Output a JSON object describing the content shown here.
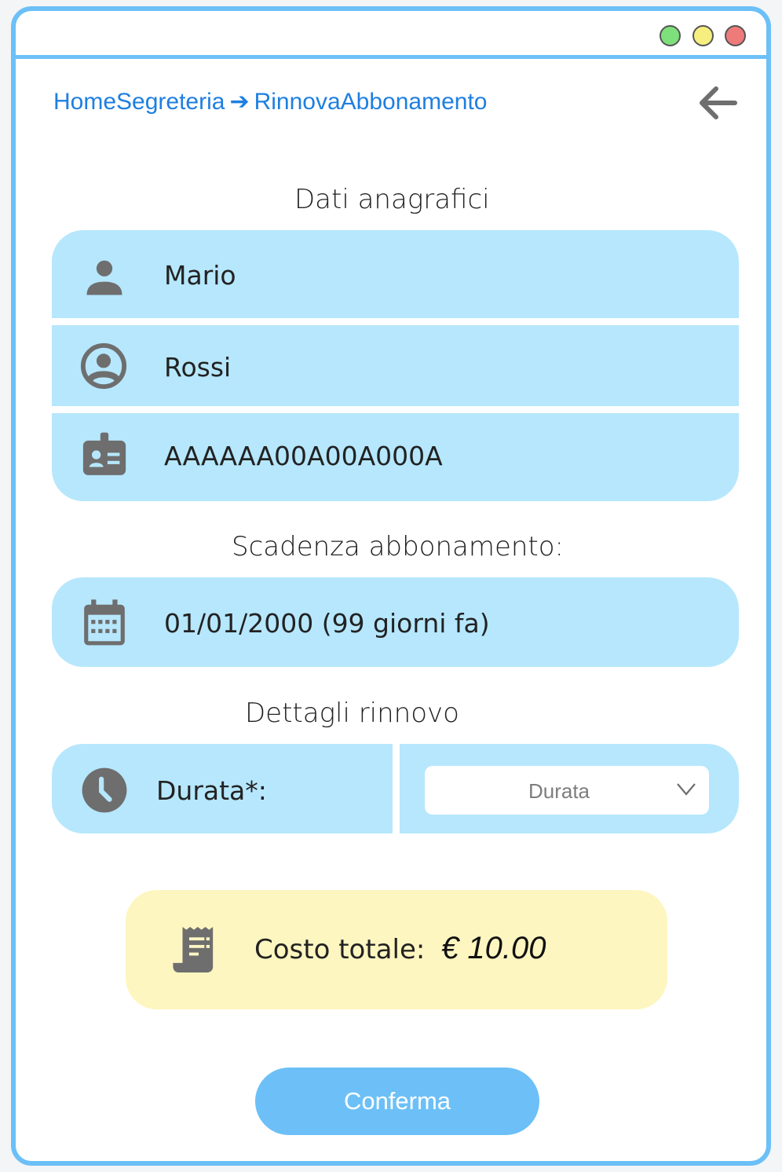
{
  "window": {
    "controls": [
      "green",
      "yellow",
      "red"
    ]
  },
  "breadcrumb": {
    "home": "HomeSegreteria",
    "separator": "➔",
    "current": "RinnovaAbbonamento"
  },
  "icons": {
    "back": "arrow-left-icon",
    "name": "person-icon",
    "surname": "account-circle-icon",
    "fiscal_code": "badge-icon",
    "expiry": "calendar-icon",
    "duration": "clock-icon",
    "dropdown": "chevron-down-icon",
    "total": "receipt-icon"
  },
  "anagrafica": {
    "title": "Dati anagrafici",
    "name": "Mario",
    "surname": "Rossi",
    "fiscal_code": "AAAAAA00A00A000A"
  },
  "scadenza": {
    "title": "Scadenza abbonamento:",
    "value": "01/01/2000 (99 giorni fa)"
  },
  "rinnovo": {
    "title": "Dettagli rinnovo",
    "duration_label": "Durata*:",
    "duration_placeholder": "Durata"
  },
  "totale": {
    "label": "Costo totale:",
    "amount": "€ 10.00"
  },
  "actions": {
    "confirm": "Conferma"
  },
  "colors": {
    "accent": "#6cc0f7",
    "panel": "#b6e7fd",
    "total_bg": "#fdf6c0",
    "link": "#1e7fe0",
    "icon": "#6e6e6e"
  }
}
